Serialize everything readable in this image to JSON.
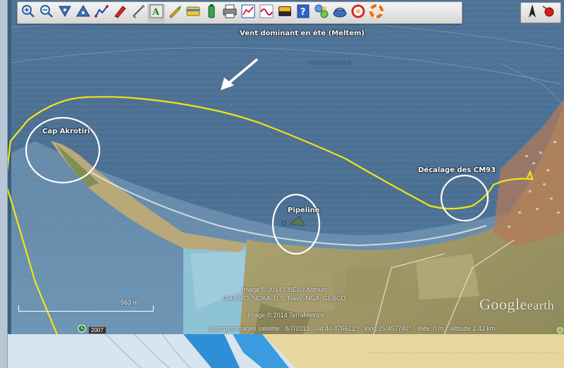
{
  "toolbar": {
    "buttons": [
      {
        "icon": "zoom-in-icon"
      },
      {
        "icon": "zoom-out-icon"
      },
      {
        "icon": "route-down-icon"
      },
      {
        "icon": "route-up-icon"
      },
      {
        "icon": "track-icon"
      },
      {
        "icon": "boat-icon"
      },
      {
        "icon": "measure-icon"
      },
      {
        "icon": "text-annotation-icon"
      },
      {
        "icon": "mark-icon"
      },
      {
        "icon": "layers-icon"
      },
      {
        "icon": "gps-battery-icon"
      },
      {
        "icon": "print-icon"
      },
      {
        "icon": "graph-icon"
      },
      {
        "icon": "tide-icon"
      },
      {
        "icon": "lighting-icon"
      },
      {
        "icon": "help-icon"
      },
      {
        "icon": "settings-icon"
      },
      {
        "icon": "ais-icon"
      },
      {
        "icon": "sos-icon"
      },
      {
        "icon": "lifebuoy-icon"
      }
    ]
  },
  "map": {
    "wind_label": "Vent dominant en été (Meltem)",
    "cape_label": "Cap Akrotiri",
    "pipeline_label": "Pipeline",
    "offset_label": "Décalage des CM93",
    "place_name": "Kamanotissa B.",
    "track_color": "#f2e60f",
    "circle_color": "#ffffff"
  },
  "credits": {
    "line1": "Image © 2014 CNES / Astrium",
    "line2": "Data SIO, NOAA, U.S. Navy, NGA, GEBCO",
    "line3": "Image © 2014 TerraMetrics"
  },
  "scale": {
    "label": "563 m"
  },
  "history": {
    "year": "2007"
  },
  "google": {
    "brand": "Google",
    "suffix": "earth"
  },
  "status": {
    "date": "Date des images satellite : 8/7/2013",
    "lat_label": "lat",
    "lat_value": "40.476621°",
    "long_label": "long",
    "long_value": "25.457740°",
    "elev_label": "élév.",
    "elev_value": "0 m",
    "alt_label": "altitude",
    "alt_value": "2.43 km"
  }
}
